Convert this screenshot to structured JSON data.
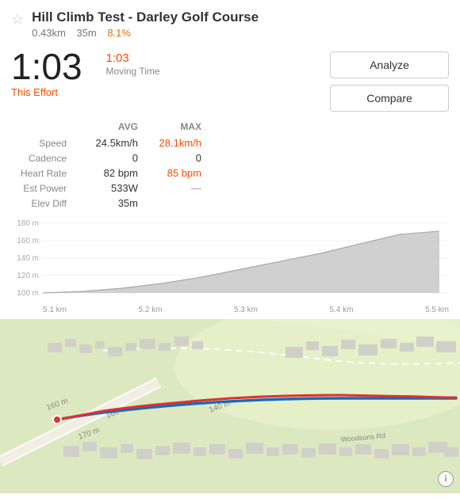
{
  "header": {
    "title": "Hill Climb Test - Darley Golf Course",
    "distance": "0.43km",
    "elevation": "35m",
    "grade": "8.1%",
    "star_icon": "☆"
  },
  "effort": {
    "time": "1:03",
    "label": "This Effort",
    "moving_time": "1:03",
    "moving_label": "Moving Time"
  },
  "buttons": {
    "analyze": "Analyze",
    "compare": "Compare"
  },
  "metrics": {
    "col_avg": "AVG",
    "col_max": "MAX",
    "rows": [
      {
        "name": "Speed",
        "avg": "24.5km/h",
        "max": "28.1km/h",
        "max_accent": true
      },
      {
        "name": "Cadence",
        "avg": "0",
        "max": "0",
        "max_accent": false
      },
      {
        "name": "Heart Rate",
        "avg": "82 bpm",
        "max": "85 bpm",
        "max_accent": true
      },
      {
        "name": "Est Power",
        "avg": "533W",
        "max": "—",
        "max_accent": false,
        "dash": true
      },
      {
        "name": "Elev Diff",
        "avg": "35m",
        "max": "",
        "max_accent": false
      }
    ]
  },
  "chart": {
    "y_labels": [
      "180 m",
      "160 m",
      "140 m",
      "120 m",
      "100 m"
    ],
    "x_labels": [
      "5.1 km",
      "5.2 km",
      "5.3 km",
      "5.4 km",
      "5.5 km"
    ]
  },
  "map": {
    "info_icon": "i"
  }
}
